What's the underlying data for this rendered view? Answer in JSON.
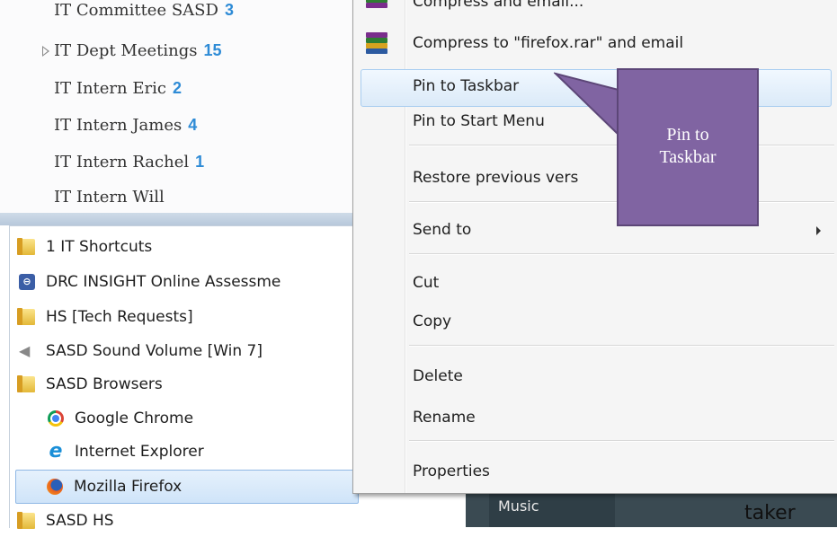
{
  "folders": [
    {
      "name": "IT Committee SASD",
      "count": "3"
    },
    {
      "name": "IT Dept Meetings",
      "count": "15",
      "expandable": true
    },
    {
      "name": "IT Intern Eric",
      "count": "2"
    },
    {
      "name": "IT Intern James",
      "count": "4"
    },
    {
      "name": "IT Intern Rachel",
      "count": "1"
    },
    {
      "name": "IT Intern Will",
      "count": ""
    }
  ],
  "start_menu": {
    "items": [
      {
        "label": "1 IT Shortcuts",
        "icon": "folder-icon"
      },
      {
        "label": "DRC INSIGHT Online Assessme",
        "icon": "drc-insight-icon"
      },
      {
        "label": "HS [Tech Requests]",
        "icon": "folder-icon"
      },
      {
        "label": "SASD Sound Volume [Win 7]",
        "icon": "speaker-icon"
      },
      {
        "label": "SASD Browsers",
        "icon": "folder-icon"
      },
      {
        "label": "Google Chrome",
        "icon": "chrome-icon"
      },
      {
        "label": "Internet Explorer",
        "icon": "internet-explorer-icon"
      },
      {
        "label": "Mozilla Firefox",
        "icon": "firefox-icon",
        "selected": true
      },
      {
        "label": "SASD HS",
        "icon": "folder-icon"
      }
    ],
    "music": "Music",
    "partial_text": "taker"
  },
  "context_menu": {
    "compress_email": "Compress and email...",
    "compress_rar_email": "Compress to \"firefox.rar\" and email",
    "pin_taskbar": "Pin to Taskbar",
    "pin_start": "Pin to Start Menu",
    "restore": "Restore previous vers",
    "send_to": "Send to",
    "cut": "Cut",
    "copy": "Copy",
    "delete": "Delete",
    "rename": "Rename",
    "properties": "Properties"
  },
  "callout": {
    "line1": "Pin to",
    "line2": "Taskbar",
    "color": "#8064a2"
  }
}
